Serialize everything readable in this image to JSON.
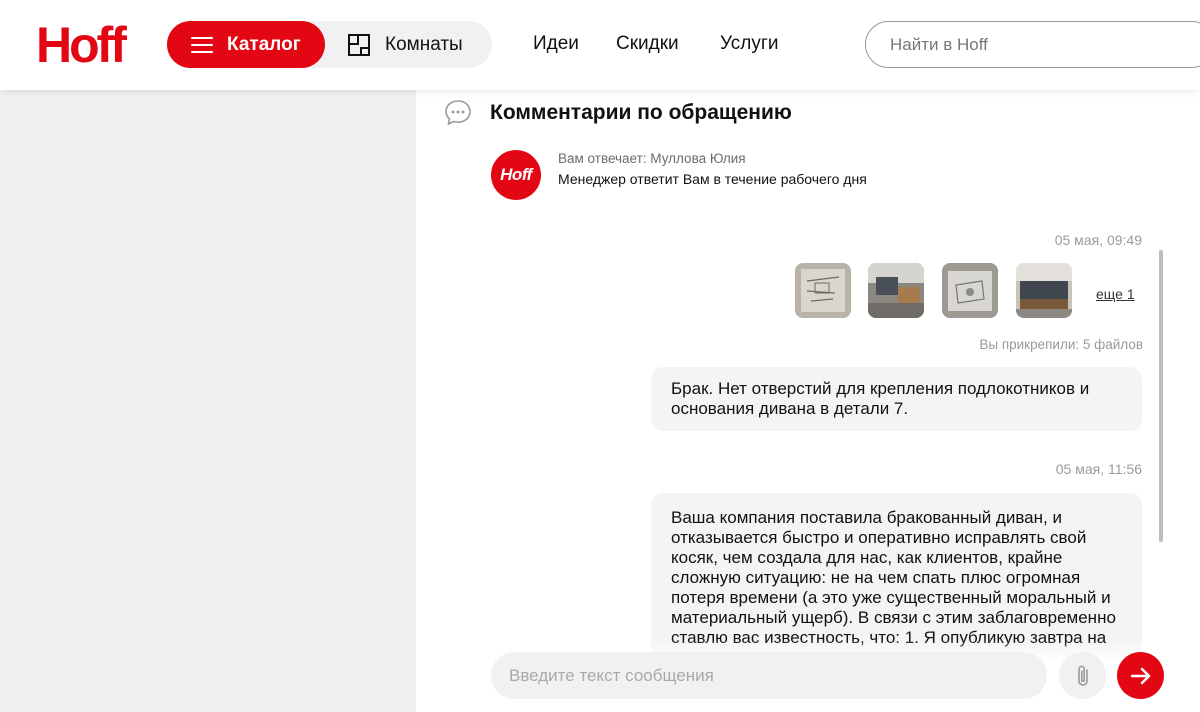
{
  "brand": {
    "logo_text": "Hoff",
    "accent": "#e30613"
  },
  "header": {
    "catalog_label": "Каталог",
    "rooms_label": "Комнаты",
    "nav": [
      "Идеи",
      "Скидки",
      "Услуги"
    ],
    "search_placeholder": "Найти в Hoff"
  },
  "comments": {
    "title": "Комментарии по обращению",
    "avatar_text": "Hoff",
    "responder": "Вам отвечает: Муллова Юлия",
    "responder_note": "Менеджер ответит Вам в течение рабочего дня"
  },
  "messages": [
    {
      "timestamp": "05 мая, 09:49",
      "attachments_visible": 4,
      "more_label": "еще 1",
      "attached_note": "Вы прикрепили: 5 файлов",
      "text": "Брак. Нет отверстий для крепления подлокотников и основания дивана в детали 7."
    },
    {
      "timestamp": "05 мая, 11:56",
      "text": "Ваша компания поставила бракованный диван, и отказывается быстро и оперативно исправлять свой косяк, чем создала для нас, как клиентов, крайне сложную ситуацию: не на чем спать плюс огромная потеря времени (а это уже существенный моральный и материальный ущерб). В связи с этим заблаговременно ставлю вас известность, что: 1. Я опубликую завтра на своих ресурсах материал о"
    }
  ],
  "composer": {
    "placeholder": "Введите текст сообщения"
  },
  "icons": [
    "burger-icon",
    "rooms-icon",
    "comments-icon",
    "paperclip-icon",
    "arrow-right-icon"
  ]
}
